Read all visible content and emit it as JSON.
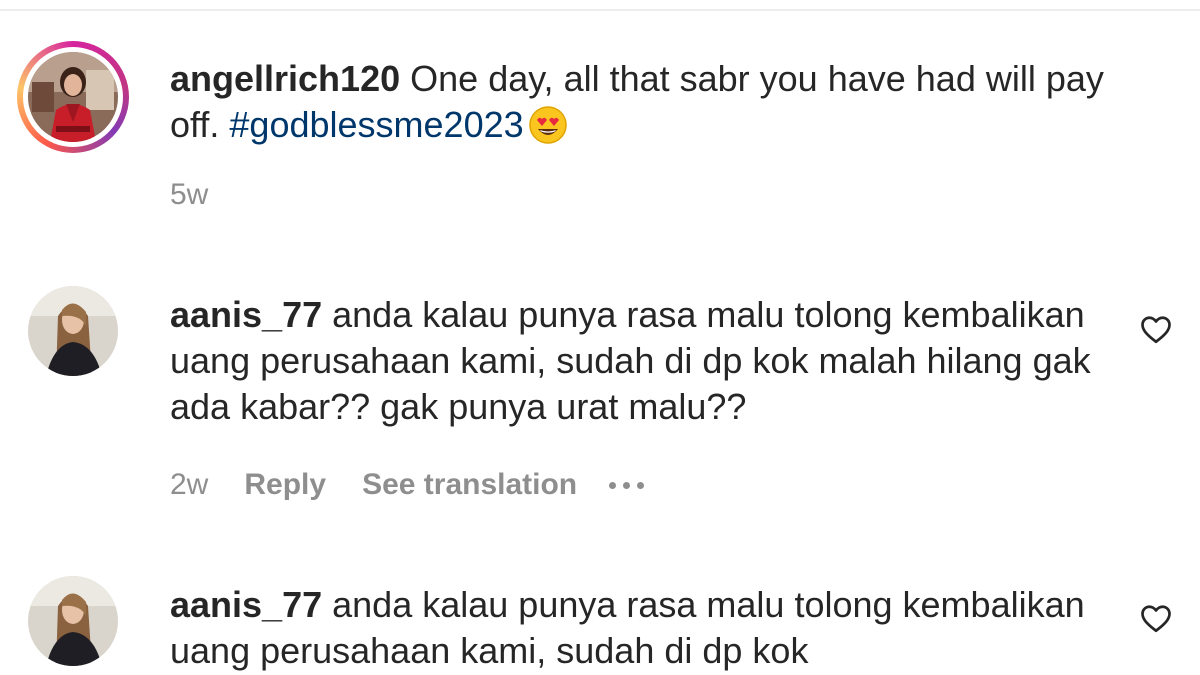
{
  "post": {
    "username": "angellrich120",
    "caption": "One day, all that sabr you have had will pay off.",
    "hashtag": "#godblessme2023",
    "emoji": "heart-eyes-emoji",
    "time": "5w"
  },
  "comments": [
    {
      "username": "aanis_77",
      "text": "anda kalau punya rasa malu tolong kembalikan uang perusahaan kami, sudah di dp kok malah hilang gak ada kabar?? gak punya urat malu??",
      "time": "2w",
      "reply_label": "Reply",
      "translate_label": "See translation",
      "more_icon": "more-options-icon",
      "like_icon": "heart-outline-icon"
    },
    {
      "username": "aanis_77",
      "text": "anda kalau punya rasa malu tolong kembalikan uang perusahaan kami, sudah di dp kok",
      "like_icon": "heart-outline-icon"
    }
  ],
  "colors": {
    "text": "#262626",
    "secondary": "#8e8e8e",
    "hashtag": "#00376b",
    "story_ring_start": "#d6249f",
    "story_ring_end": "#fdc468"
  }
}
